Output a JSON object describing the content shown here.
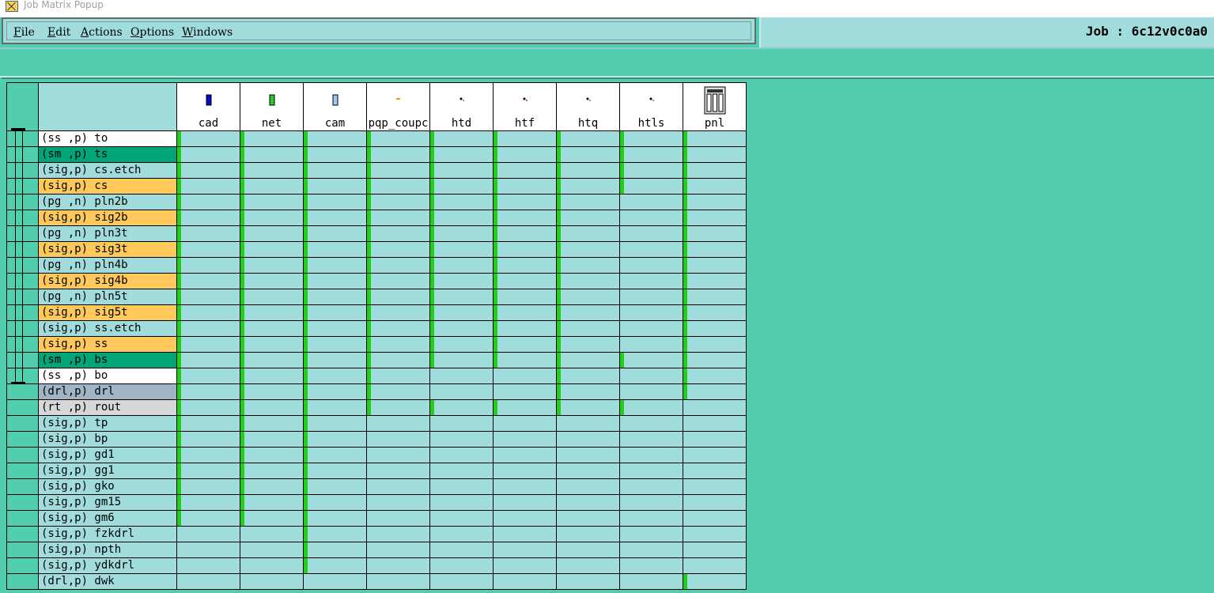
{
  "window": {
    "title": "Job Matrix Popup"
  },
  "menu": [
    {
      "label": "File",
      "mnemonic": "F",
      "rest": "ile"
    },
    {
      "label": "Edit",
      "mnemonic": "E",
      "rest": "dit"
    },
    {
      "label": "Actions",
      "mnemonic": "A",
      "rest": "ctions"
    },
    {
      "label": "Options",
      "mnemonic": "O",
      "rest": "ptions"
    },
    {
      "label": "Windows",
      "mnemonic": "W",
      "rest": "indows"
    }
  ],
  "job": {
    "label": "Job : 6c12v0c0a0"
  },
  "colors": {
    "board_bg": "#a1dcdc",
    "signal": "#ffc85a",
    "soldermask": "#00a578",
    "silkscreen": "#ffffff",
    "drill": "#a0b4c3",
    "rout": "#d7d7d7",
    "exists": "#22d01a"
  },
  "steps": [
    {
      "name": "cad",
      "icon": "step-icon-blue"
    },
    {
      "name": "net",
      "icon": "step-icon-green"
    },
    {
      "name": "cam",
      "icon": "step-icon-light"
    },
    {
      "name": "pqp_coupc",
      "icon": "step-icon-dash"
    },
    {
      "name": "htd",
      "icon": "step-icon-dot"
    },
    {
      "name": "htf",
      "icon": "step-icon-dot-red"
    },
    {
      "name": "htq",
      "icon": "step-icon-dot"
    },
    {
      "name": "htls",
      "icon": "step-icon-dot"
    },
    {
      "name": "pnl",
      "icon": "panel-icon"
    }
  ],
  "layers": [
    {
      "label": "(ss ,p) to",
      "type": "silkscreen",
      "board": true,
      "cells": [
        1,
        1,
        1,
        1,
        1,
        1,
        1,
        1,
        1
      ]
    },
    {
      "label": "(sm ,p) ts",
      "type": "soldermask",
      "board": true,
      "cells": [
        1,
        1,
        1,
        1,
        1,
        1,
        1,
        1,
        1
      ]
    },
    {
      "label": "(sig,p) cs.etch",
      "type": "plain",
      "board": true,
      "cells": [
        1,
        1,
        1,
        1,
        1,
        1,
        1,
        1,
        1
      ]
    },
    {
      "label": "(sig,p) cs",
      "type": "signal",
      "board": true,
      "cells": [
        1,
        1,
        1,
        1,
        1,
        1,
        1,
        1,
        1
      ]
    },
    {
      "label": "(pg ,n) pln2b",
      "type": "plain",
      "board": true,
      "cells": [
        1,
        1,
        1,
        1,
        1,
        1,
        1,
        0,
        1
      ]
    },
    {
      "label": "(sig,p) sig2b",
      "type": "signal",
      "board": true,
      "cells": [
        1,
        1,
        1,
        1,
        1,
        1,
        1,
        0,
        1
      ]
    },
    {
      "label": "(pg ,n) pln3t",
      "type": "plain",
      "board": true,
      "cells": [
        1,
        1,
        1,
        1,
        1,
        1,
        1,
        0,
        1
      ]
    },
    {
      "label": "(sig,p) sig3t",
      "type": "signal",
      "board": true,
      "cells": [
        1,
        1,
        1,
        1,
        1,
        1,
        1,
        0,
        1
      ]
    },
    {
      "label": "(pg ,n) pln4b",
      "type": "plain",
      "board": true,
      "cells": [
        1,
        1,
        1,
        1,
        1,
        1,
        1,
        0,
        1
      ]
    },
    {
      "label": "(sig,p) sig4b",
      "type": "signal",
      "board": true,
      "cells": [
        1,
        1,
        1,
        1,
        1,
        1,
        1,
        0,
        1
      ]
    },
    {
      "label": "(pg ,n) pln5t",
      "type": "plain",
      "board": true,
      "cells": [
        1,
        1,
        1,
        1,
        1,
        1,
        1,
        0,
        1
      ]
    },
    {
      "label": "(sig,p) sig5t",
      "type": "signal",
      "board": true,
      "cells": [
        1,
        1,
        1,
        1,
        1,
        1,
        1,
        0,
        1
      ]
    },
    {
      "label": "(sig,p) ss.etch",
      "type": "plain",
      "board": true,
      "cells": [
        1,
        1,
        1,
        1,
        1,
        1,
        1,
        0,
        1
      ]
    },
    {
      "label": "(sig,p) ss",
      "type": "signal",
      "board": true,
      "cells": [
        1,
        1,
        1,
        1,
        1,
        1,
        1,
        0,
        1
      ]
    },
    {
      "label": "(sm ,p) bs",
      "type": "soldermask",
      "board": true,
      "cells": [
        1,
        1,
        1,
        1,
        1,
        1,
        1,
        1,
        1
      ]
    },
    {
      "label": "(ss ,p) bo",
      "type": "silkscreen",
      "board": true,
      "cells": [
        1,
        1,
        1,
        1,
        0,
        0,
        1,
        0,
        1
      ]
    },
    {
      "label": "(drl,p) drl",
      "type": "drill",
      "board": false,
      "cells": [
        1,
        1,
        1,
        1,
        0,
        0,
        1,
        0,
        1
      ]
    },
    {
      "label": "(rt ,p) rout",
      "type": "rout",
      "board": false,
      "cells": [
        1,
        1,
        1,
        1,
        1,
        1,
        1,
        1,
        0
      ]
    },
    {
      "label": "(sig,p) tp",
      "type": "plain",
      "board": false,
      "cells": [
        1,
        1,
        1,
        0,
        0,
        0,
        0,
        0,
        0
      ]
    },
    {
      "label": "(sig,p) bp",
      "type": "plain",
      "board": false,
      "cells": [
        1,
        1,
        1,
        0,
        0,
        0,
        0,
        0,
        0
      ]
    },
    {
      "label": "(sig,p) gd1",
      "type": "plain",
      "board": false,
      "cells": [
        1,
        1,
        1,
        0,
        0,
        0,
        0,
        0,
        0
      ]
    },
    {
      "label": "(sig,p) gg1",
      "type": "plain",
      "board": false,
      "cells": [
        1,
        1,
        1,
        0,
        0,
        0,
        0,
        0,
        0
      ]
    },
    {
      "label": "(sig,p) gko",
      "type": "plain",
      "board": false,
      "cells": [
        1,
        1,
        1,
        0,
        0,
        0,
        0,
        0,
        0
      ]
    },
    {
      "label": "(sig,p) gm15",
      "type": "plain",
      "board": false,
      "cells": [
        1,
        1,
        1,
        0,
        0,
        0,
        0,
        0,
        0
      ]
    },
    {
      "label": "(sig,p) gm6",
      "type": "plain",
      "board": false,
      "cells": [
        1,
        1,
        1,
        0,
        0,
        0,
        0,
        0,
        0
      ]
    },
    {
      "label": "(sig,p) fzkdrl",
      "type": "plain",
      "board": false,
      "cells": [
        0,
        0,
        1,
        0,
        0,
        0,
        0,
        0,
        0
      ]
    },
    {
      "label": "(sig,p) npth",
      "type": "plain",
      "board": false,
      "cells": [
        0,
        0,
        1,
        0,
        0,
        0,
        0,
        0,
        0
      ]
    },
    {
      "label": "(sig,p) ydkdrl",
      "type": "plain",
      "board": false,
      "cells": [
        0,
        0,
        1,
        0,
        0,
        0,
        0,
        0,
        0
      ]
    },
    {
      "label": "(drl,p) dwk",
      "type": "plain",
      "board": false,
      "cells": [
        0,
        0,
        0,
        0,
        0,
        0,
        0,
        0,
        1
      ]
    }
  ]
}
